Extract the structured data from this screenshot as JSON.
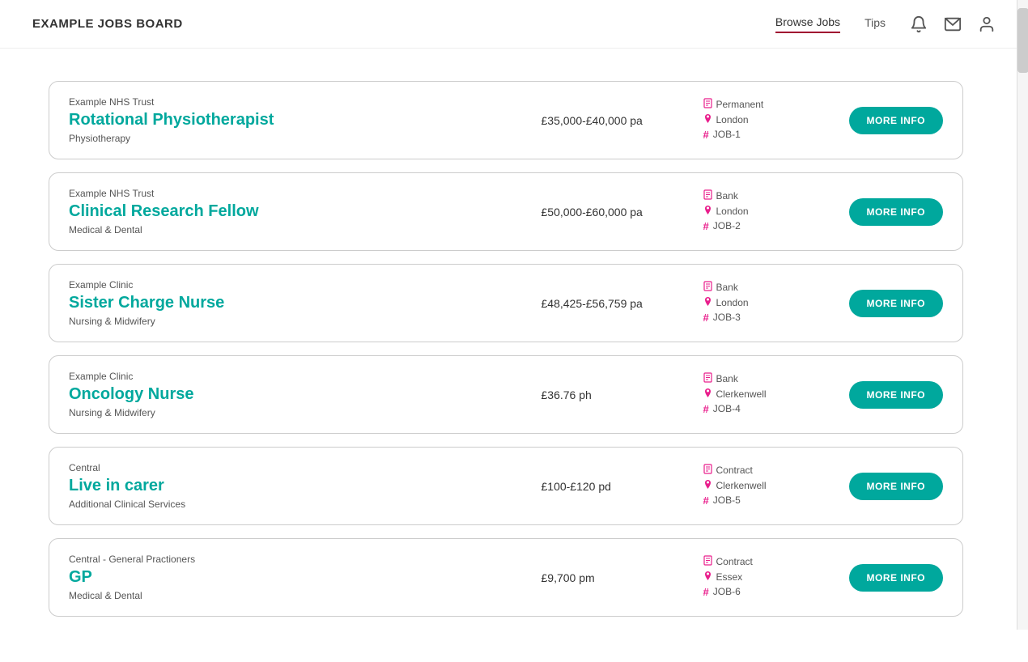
{
  "header": {
    "logo": "EXAMPLE JOBS BOARD",
    "nav": [
      {
        "label": "Browse Jobs",
        "active": true
      },
      {
        "label": "Tips",
        "active": false
      }
    ],
    "icons": [
      "bell",
      "mail",
      "user"
    ]
  },
  "jobs": [
    {
      "org": "Example NHS Trust",
      "title": "Rotational Physiotherapist",
      "category": "Physiotherapy",
      "salary": "£35,000-£40,000 pa",
      "type": "Permanent",
      "location": "London",
      "id": "JOB-1",
      "btn": "MORE INFO"
    },
    {
      "org": "Example NHS Trust",
      "title": "Clinical Research Fellow",
      "category": "Medical & Dental",
      "salary": "£50,000-£60,000 pa",
      "type": "Bank",
      "location": "London",
      "id": "JOB-2",
      "btn": "MORE INFO"
    },
    {
      "org": "Example Clinic",
      "title": "Sister Charge Nurse",
      "category": "Nursing & Midwifery",
      "salary": "£48,425-£56,759 pa",
      "type": "Bank",
      "location": "London",
      "id": "JOB-3",
      "btn": "MORE INFO"
    },
    {
      "org": "Example Clinic",
      "title": "Oncology Nurse",
      "category": "Nursing & Midwifery",
      "salary": "£36.76 ph",
      "type": "Bank",
      "location": "Clerkenwell",
      "id": "JOB-4",
      "btn": "MORE INFO"
    },
    {
      "org": "Central",
      "title": "Live in carer",
      "category": "Additional Clinical Services",
      "salary": "£100-£120 pd",
      "type": "Contract",
      "location": "Clerkenwell",
      "id": "JOB-5",
      "btn": "MORE INFO"
    },
    {
      "org": "Central - General Practioners",
      "title": "GP",
      "category": "Medical & Dental",
      "salary": "£9,700 pm",
      "type": "Contract",
      "location": "Essex",
      "id": "JOB-6",
      "btn": "MORE INFO"
    }
  ]
}
